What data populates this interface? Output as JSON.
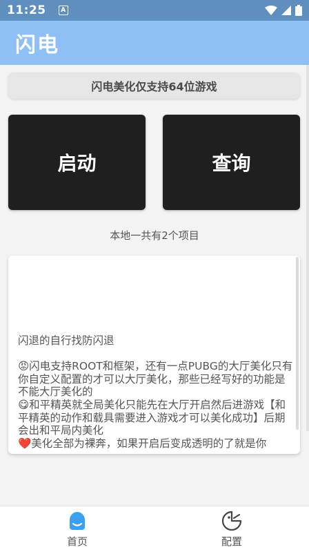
{
  "status_bar": {
    "time": "11:25",
    "notification_icon": "a-icon",
    "icons": [
      "wifi-icon",
      "signal-icon",
      "battery-icon"
    ]
  },
  "app_bar": {
    "title": "闪电"
  },
  "notice": {
    "text": "闪电美化仅支持64位游戏"
  },
  "buttons": {
    "start_label": "启动",
    "query_label": "查询"
  },
  "project_count": "本地一共有2个项目",
  "info_card": {
    "text": "闪退的自行找防闪退\n\n😡闪电支持ROOT和框架，还有一点PUBG的大厅美化只有你自定义配置的才可以大厅美化，那些已经写好的功能是不能大厅美化的\n😋和平精英就全局美化只能先在大厅开启然后进游戏【和平精英的动作和载具需要进入游戏才可以美化成功】后期会出和平局内美化\n❤️美化全部为裸奔，如果开启后变成透明的了就是你"
  },
  "bottom_nav": {
    "items": [
      {
        "label": "首页",
        "icon": "home-icon",
        "active": true
      },
      {
        "label": "配置",
        "icon": "config-icon",
        "active": false
      }
    ]
  },
  "colors": {
    "status_bar": "#5f8fbf",
    "app_bar": "#8ec0f6",
    "button_bg": "#1f1f1f",
    "nav_active": "#3aa0f0"
  }
}
